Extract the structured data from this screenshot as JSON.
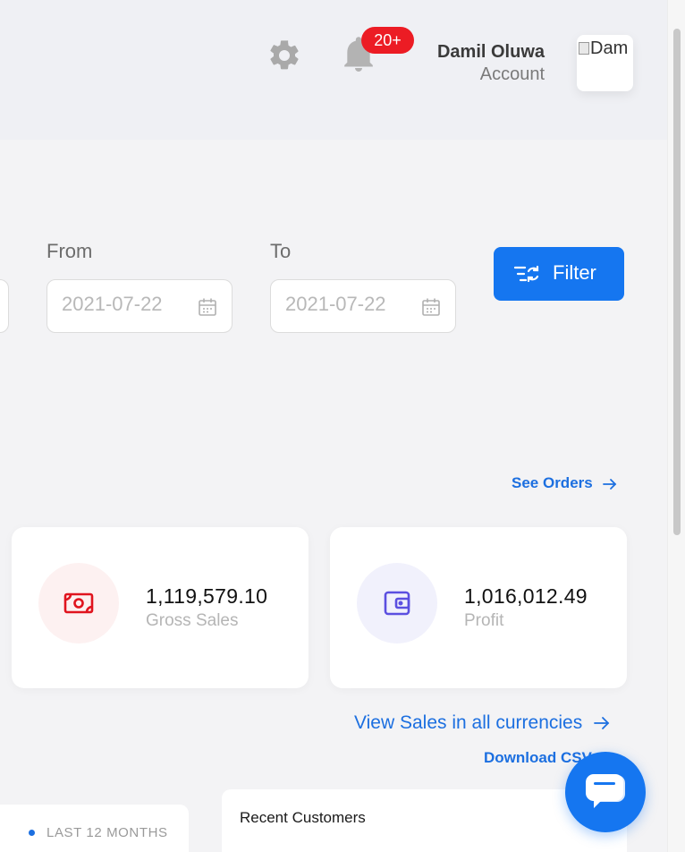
{
  "header": {
    "notification_badge": "20+",
    "user_name": "Damil Oluwa",
    "user_role": "Account",
    "avatar_alt": "Dam",
    "icons": {
      "settings": "gear-icon",
      "notifications": "bell-icon"
    }
  },
  "filters": {
    "from_label": "From",
    "to_label": "To",
    "from_placeholder": "2021-07-22",
    "to_placeholder": "2021-07-22",
    "filter_button_label": "Filter"
  },
  "links": {
    "see_orders": "See Orders",
    "view_sales_currencies": "View Sales in all currencies",
    "download_csv": "Download CSV"
  },
  "stats": [
    {
      "value": "1,119,579.10",
      "label": "Gross Sales",
      "icon": "cash-icon",
      "icon_color": "#e0141e",
      "bg": "#fdf1f1"
    },
    {
      "value": "1,016,012.49",
      "label": "Profit",
      "icon": "wallet-icon",
      "icon_color": "#5b4fe0",
      "bg": "#f1f1fc"
    }
  ],
  "panels": {
    "period_label": "LAST 12 MONTHS",
    "recent_customers_title": "Recent Customers"
  },
  "colors": {
    "primary": "#1576f0",
    "badge": "#ec1c24",
    "link": "#1c6fe0"
  }
}
